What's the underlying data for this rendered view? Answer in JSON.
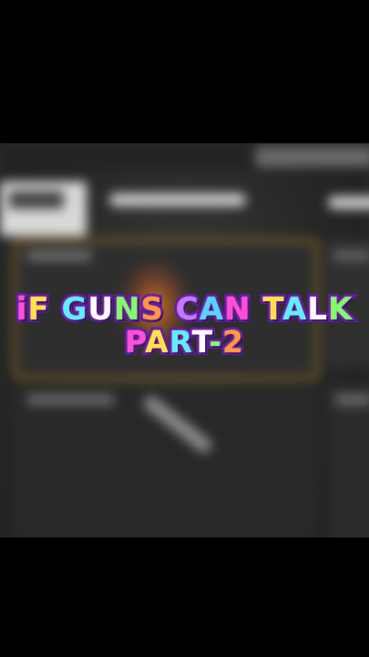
{
  "title": {
    "line1": "iF GUNS CAN TALK",
    "line2": "PART-2"
  },
  "colors": {
    "background": "#000000",
    "frame": "#2a2a2a",
    "accent_border": "#a57a22",
    "glow": "#ff8c28",
    "title_fill": "#ffffff",
    "title_outline": "#5a1fa0"
  }
}
